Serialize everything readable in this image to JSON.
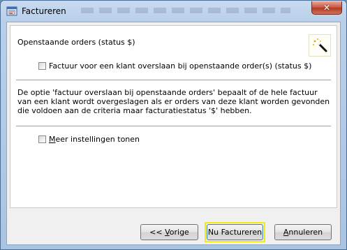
{
  "window": {
    "title": "Factureren",
    "close_glyph": "✕"
  },
  "section": {
    "title": "Openstaande orders (status $)",
    "skip_checkbox_label": "Factuur voor een klant overslaan bij openstaande order(s) (status $)",
    "skip_checked": false,
    "description": "De optie 'factuur overslaan bij openstaande orders' bepaalt of de hele factuur van een klant wordt overgeslagen als er orders van deze klant worden gevonden die voldoen aan de criteria maar facturatiestatus '$' hebben.",
    "more_settings_label_mnemonic": "M",
    "more_settings_label_rest": "eer instellingen tonen",
    "more_settings_checked": false
  },
  "buttons": {
    "back_prefix": "<< ",
    "back_mnemonic": "V",
    "back_rest": "orige",
    "invoice_now": "Nu Factureren",
    "cancel_mnemonic": "A",
    "cancel_rest": "nnuleren"
  },
  "icons": {
    "app": "application-window-icon",
    "wizard": "magic-wand-icon"
  },
  "colors": {
    "focus_ring": "#f2ea1a",
    "close_button": "#c8523c"
  }
}
